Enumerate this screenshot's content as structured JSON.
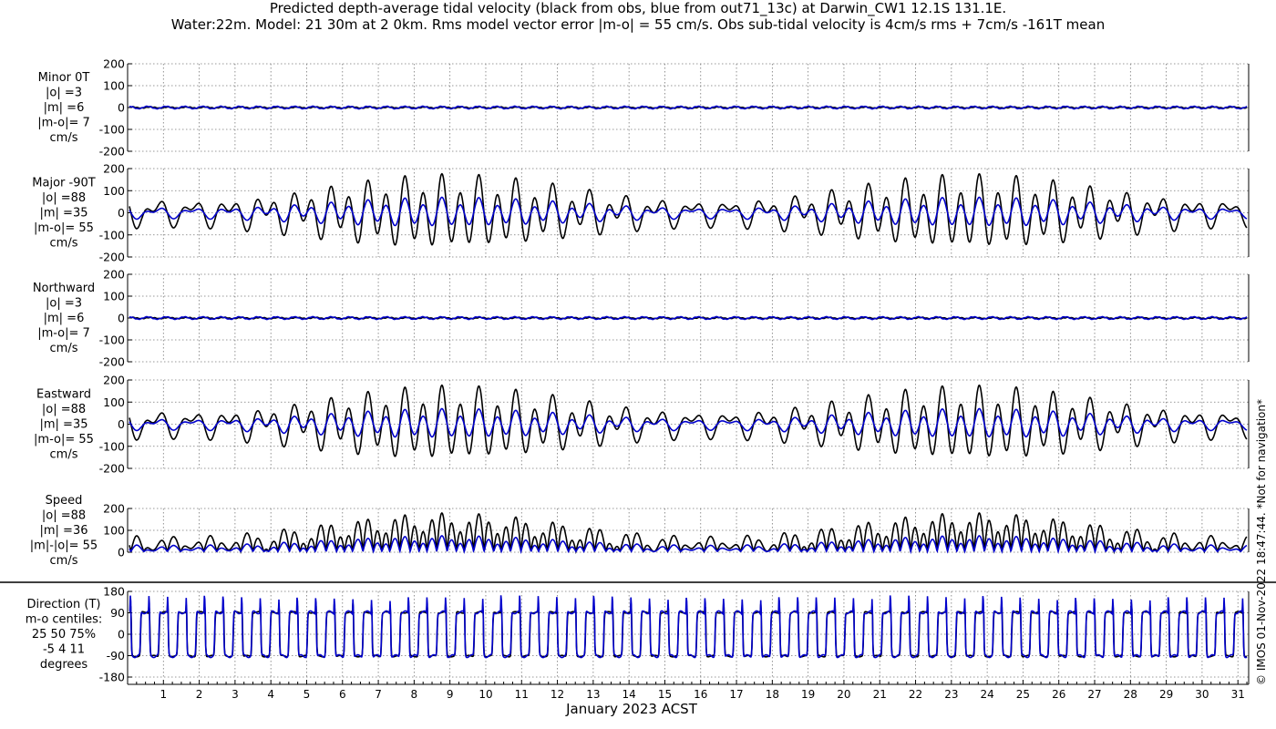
{
  "title_line1": "Predicted depth-average tidal velocity (black from obs, blue from out71_13c) at Darwin_CW1 12.1S 131.1E.",
  "title_line2": "Water:22m. Model: 21 30m at 2 0km. Rms model vector error |m-o| = 55 cm/s. Obs sub-tidal velocity is 4cm/s rms + 7cm/s -161T mean",
  "xlabel": "January 2023 ACST",
  "credit": "© IMOS 01-Nov-2022 18:47:44. *Not for navigation*",
  "colors": {
    "obs": "#000000",
    "model": "#0000cc"
  },
  "chart_data": [
    {
      "type": "line",
      "name": "minor",
      "label_lines": [
        "Minor 0T",
        "|o| =3",
        "|m| =6",
        "|m-o|= 7",
        "cm/s"
      ],
      "ylim": [
        -200,
        200
      ],
      "yticks": [
        -200,
        -100,
        0,
        100,
        200
      ],
      "series": [
        {
          "name": "black from obs",
          "amp": 3,
          "kind": "velocity"
        },
        {
          "name": "blue from out71_13c",
          "amp": 6,
          "kind": "velocity"
        }
      ]
    },
    {
      "type": "line",
      "name": "major",
      "label_lines": [
        "Major -90T",
        "|o| =88",
        "|m| =35",
        "|m-o|= 55",
        "cm/s"
      ],
      "ylim": [
        -200,
        200
      ],
      "yticks": [
        -200,
        -100,
        0,
        100,
        200
      ],
      "series": [
        {
          "name": "black from obs",
          "amp": 88,
          "kind": "velocity"
        },
        {
          "name": "blue from out71_13c",
          "amp": 35,
          "kind": "velocity"
        }
      ]
    },
    {
      "type": "line",
      "name": "northward",
      "label_lines": [
        "Northward",
        "|o| =3",
        "|m| =6",
        "|m-o|= 7",
        "cm/s"
      ],
      "ylim": [
        -200,
        200
      ],
      "yticks": [
        -200,
        -100,
        0,
        100,
        200
      ],
      "series": [
        {
          "name": "black from obs",
          "amp": 3,
          "kind": "velocity"
        },
        {
          "name": "blue from out71_13c",
          "amp": 6,
          "kind": "velocity"
        }
      ]
    },
    {
      "type": "line",
      "name": "eastward",
      "label_lines": [
        "Eastward",
        "|o| =88",
        "|m| =35",
        "|m-o|= 55",
        "cm/s"
      ],
      "ylim": [
        -200,
        200
      ],
      "yticks": [
        -200,
        -100,
        0,
        100,
        200
      ],
      "series": [
        {
          "name": "black from obs",
          "amp": 88,
          "kind": "velocity"
        },
        {
          "name": "blue from out71_13c",
          "amp": 35,
          "kind": "velocity"
        }
      ]
    },
    {
      "type": "line",
      "name": "speed",
      "label_lines": [
        "Speed",
        "|o| =88",
        "|m| =36",
        "|m|-|o|= 55",
        "cm/s"
      ],
      "ylim": [
        0,
        200
      ],
      "yticks": [
        0,
        100,
        200
      ],
      "series": [
        {
          "name": "black from obs",
          "amp": 88,
          "kind": "speed"
        },
        {
          "name": "blue from out71_13c",
          "amp": 36,
          "kind": "speed"
        }
      ]
    },
    {
      "type": "line",
      "name": "direction",
      "label_lines": [
        "Direction (T)",
        "m-o centiles:",
        "25  50  75%",
        "-5   4  11",
        "degrees"
      ],
      "ylim": [
        -180,
        180
      ],
      "yticks": [
        -180,
        -90,
        0,
        90,
        180
      ],
      "series": [
        {
          "name": "black from obs",
          "kind": "direction"
        },
        {
          "name": "blue from out71_13c",
          "kind": "direction"
        }
      ]
    }
  ],
  "xaxis": {
    "xlim": [
      0,
      31.3
    ],
    "tick_labels": [
      "1",
      "2",
      "3",
      "4",
      "5",
      "6",
      "7",
      "8",
      "9",
      "10",
      "11",
      "12",
      "13",
      "14",
      "15",
      "16",
      "17",
      "18",
      "19",
      "20",
      "21",
      "22",
      "23",
      "24",
      "25",
      "26",
      "27",
      "28",
      "29",
      "30",
      "31"
    ],
    "tick_values": [
      1,
      2,
      3,
      4,
      5,
      6,
      7,
      8,
      9,
      10,
      11,
      12,
      13,
      14,
      15,
      16,
      17,
      18,
      19,
      20,
      21,
      22,
      23,
      24,
      25,
      26,
      27,
      28,
      29,
      30,
      31
    ]
  }
}
